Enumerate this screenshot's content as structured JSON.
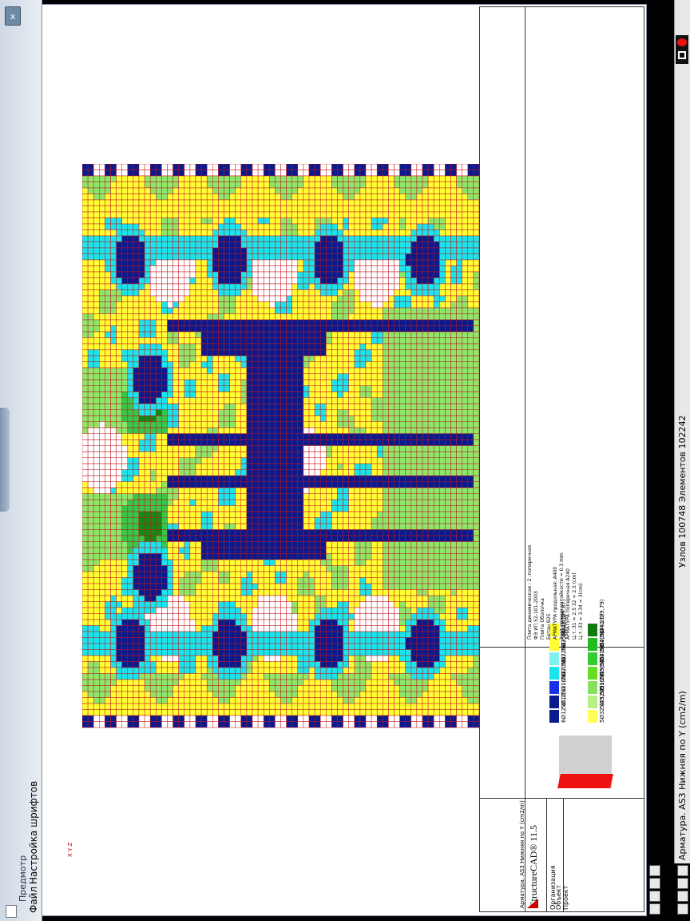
{
  "window": {
    "menu_file": "Файл",
    "menu_fonts": "Настройка шрифтов",
    "preview_title": "Предмотр",
    "close_glyph": "x"
  },
  "status": {
    "nodes_elements": "Узлов 100748 Элементов 102242",
    "layer_title": "Арматура. AS3 Нижняя по Y (cm2/m)"
  },
  "drawing": {
    "stamp_title": "Арматура. AS3 Нижняя по Y (cm2/m)",
    "software": "StructureCAD® 11.5",
    "org_label": "Организация",
    "object_label": "Объект",
    "project_label": "Проект",
    "axis_label": "X Y Z",
    "params": [
      "Плита динамическая : 2 -поперечная",
      "ФЭ ИП 52-101-2003",
      "Плита Оболочка",
      "Бетон B25",
      "АРМАТУРА продольная: A400",
      "Учет трещиностойкости  = 0.3 mm",
      "АРМАТУРА поперечная A240",
      "Ц.т.:31 =  2.5  32 =  2.5 (cm)",
      "Ц.т.:33 =  3.34 =   3(cm)"
    ],
    "legend": [
      {
        "label": "6Ø12 (6,7)",
        "color": "#0a1a8c"
      },
      {
        "label": "5Ø12 (11,26)",
        "color": "#0a1a8c"
      },
      {
        "label": "5Ø16 (17,08)",
        "color": "#1830e8"
      },
      {
        "label": "5Ø20 (22,79)",
        "color": "#19e6ec"
      },
      {
        "label": "5Ø22 (23,48)",
        "color": "#80f0f0"
      },
      {
        "label": "5Ø25 (24,15)",
        "color": "#ffff33"
      },
      {
        "label": "5Ø28 (29,87)",
        "color": "#ffff33"
      },
      {
        "label": "5Ø32 (45,57)",
        "color": "#ffff55"
      },
      {
        "label": "5Ø32 (51,27)",
        "color": "#b8f088"
      },
      {
        "label": "5Ø36 (45,56)",
        "color": "#88e060"
      },
      {
        "label": "5Ø36 (62,88)",
        "color": "#66dd22"
      },
      {
        "label": "5Ø40 (62,36)",
        "color": "#33cc33"
      },
      {
        "label": "5Ø40 (74,26)",
        "color": "#22bb22"
      },
      {
        "label": "5Ø40 (79,79)",
        "color": "#117a11"
      }
    ]
  },
  "colors": {
    "empty_cell": "#ffffff",
    "cell_border": "#c0141e",
    "dark_blue": "#0a1a8c",
    "cyan": "#19e6ec",
    "yellow": "#ffff33",
    "light_green": "#8de86a",
    "green": "#39c64a",
    "dark_green": "#138a13"
  }
}
